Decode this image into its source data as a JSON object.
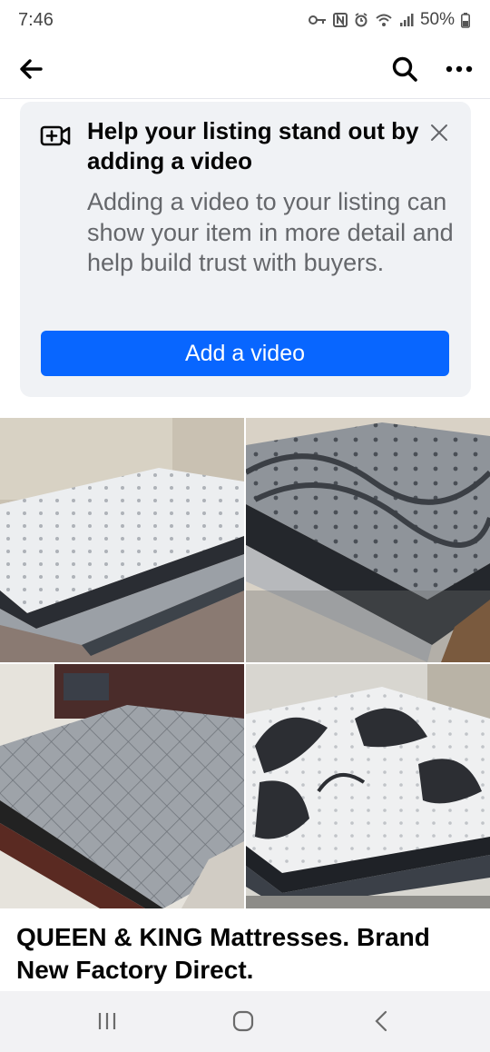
{
  "status_bar": {
    "time": "7:46",
    "battery": "50%",
    "icons": [
      "vpn-key-icon",
      "nfc-icon",
      "alarm-icon",
      "wifi-icon",
      "signal-icon",
      "battery-icon"
    ]
  },
  "top_bar": {
    "icons": [
      "back-arrow-icon",
      "search-icon",
      "more-options-icon"
    ]
  },
  "video_prompt": {
    "title": "Help your listing stand out by adding a video",
    "body": "Adding a video to your listing can show your item in more detail and help build trust with buyers.",
    "button_label": "Add a video",
    "icons": [
      "add-video-icon",
      "close-icon"
    ],
    "accent_color": "#0866ff"
  },
  "listing": {
    "photo_count_in_collage": 4,
    "title": "QUEEN & KING Mattresses. Brand New Factory Direct."
  },
  "nav_bar": {
    "icons": [
      "recent-apps-icon",
      "home-icon",
      "back-icon"
    ]
  }
}
